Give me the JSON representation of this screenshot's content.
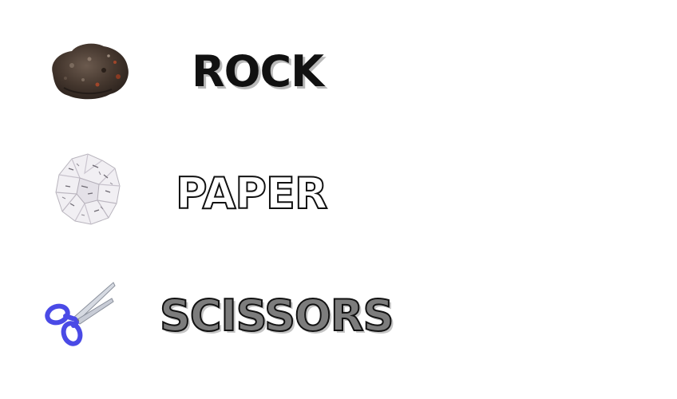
{
  "choices": [
    {
      "id": "rock",
      "label": "ROCK",
      "icon": "rock-icon"
    },
    {
      "id": "paper",
      "label": "PAPER",
      "icon": "crumpled-paper-icon"
    },
    {
      "id": "scissors",
      "label": "SCISSORS",
      "icon": "scissors-icon"
    }
  ],
  "colors": {
    "background": "#ffffff",
    "label_dark": "#111111",
    "label_shadow": "#b9b9b9",
    "scissors_fill": "#7c7c7c",
    "scissors_handle": "#4a4ae6",
    "rock_base": "#4a3b33",
    "rock_rust": "#8a3a22",
    "paper_fill": "#f1eff3"
  }
}
